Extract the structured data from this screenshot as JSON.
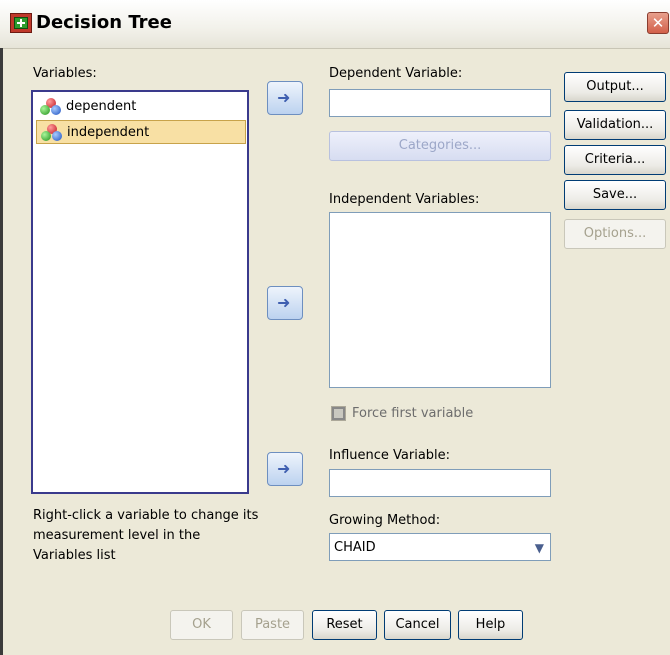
{
  "window": {
    "title": "Decision Tree",
    "close_glyph": "✕"
  },
  "variables": {
    "label": "Variables:",
    "items": [
      {
        "name": "dependent",
        "icon": "nominal-variable-icon",
        "selected": false
      },
      {
        "name": "independent",
        "icon": "nominal-variable-icon",
        "selected": true
      }
    ],
    "hint": "Right-click a variable to change its measurement level in the Variables list"
  },
  "dependent": {
    "label": "Dependent Variable:",
    "value": "",
    "categories_button": "Categories..."
  },
  "independent": {
    "label": "Independent Variables:",
    "force_first_label": "Force first variable",
    "force_first_checked": false
  },
  "influence": {
    "label": "Influence Variable:",
    "value": ""
  },
  "growing": {
    "label": "Growing Method:",
    "value": "CHAID"
  },
  "side_buttons": {
    "output": "Output...",
    "validation": "Validation...",
    "criteria": "Criteria...",
    "save": "Save...",
    "options": "Options..."
  },
  "bottom_buttons": {
    "ok": "OK",
    "paste": "Paste",
    "reset": "Reset",
    "cancel": "Cancel",
    "help": "Help"
  },
  "arrow_glyph": "➜"
}
